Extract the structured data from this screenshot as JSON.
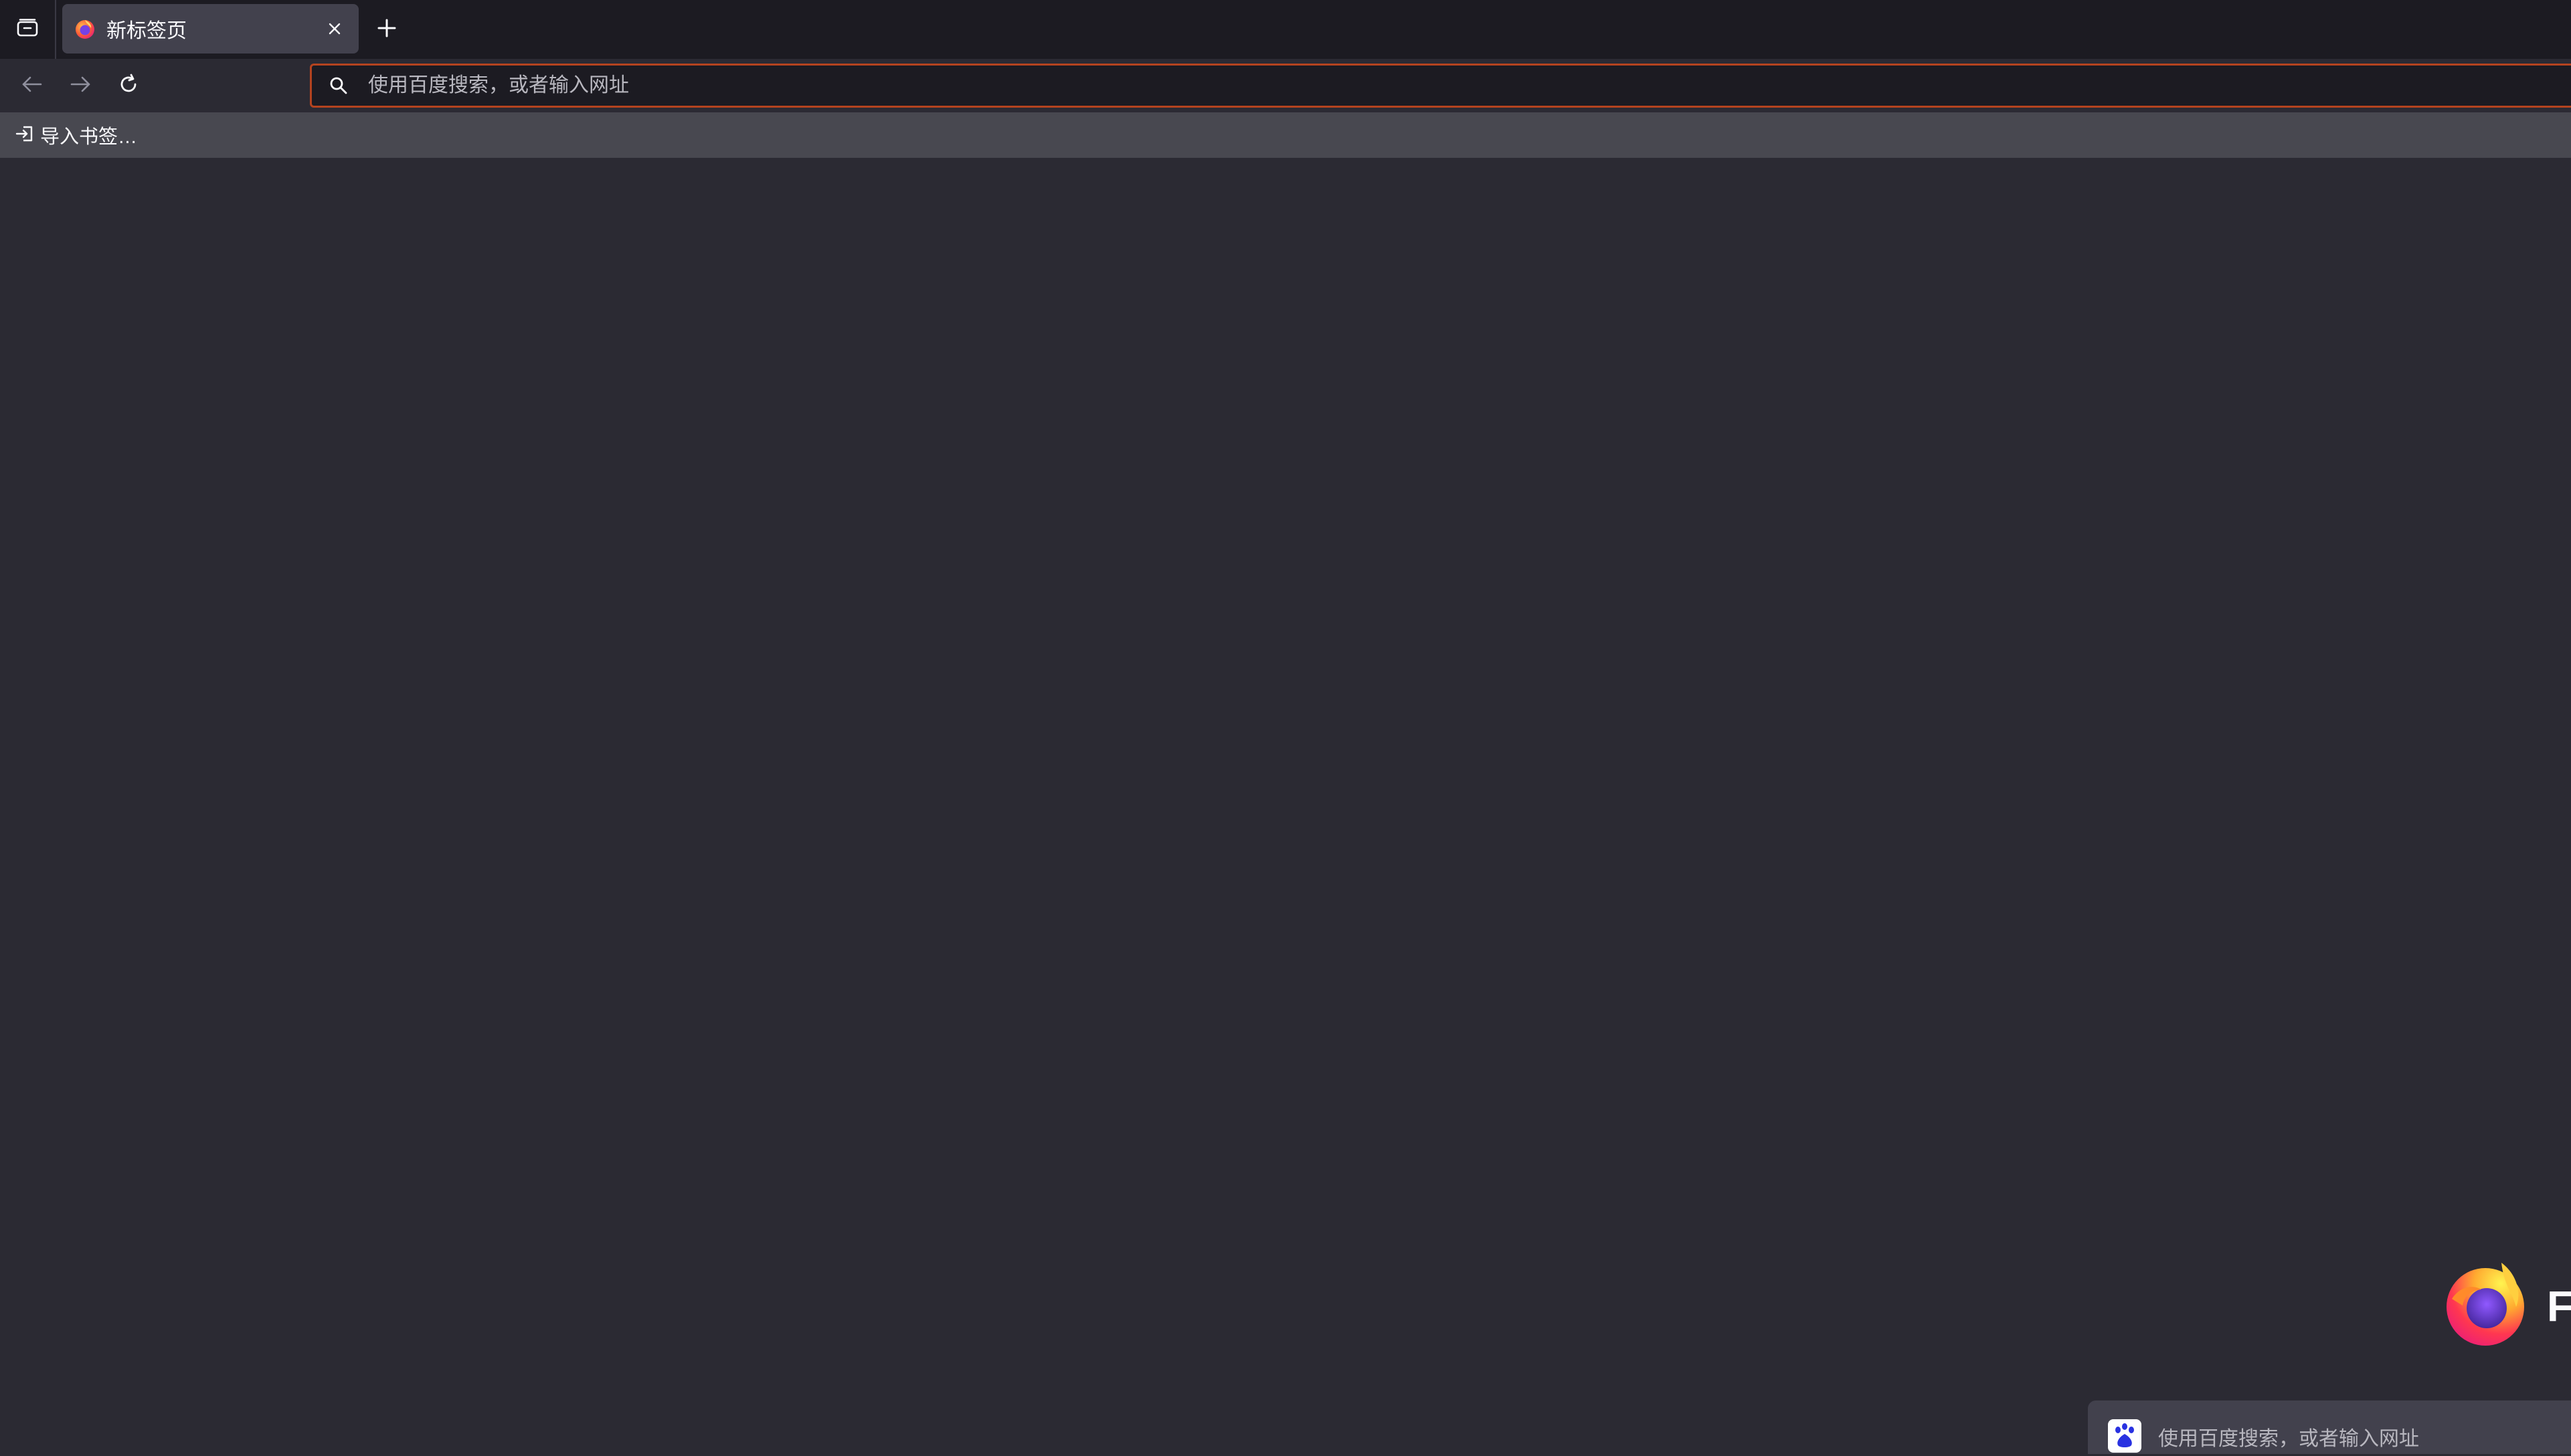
{
  "tabbar": {
    "tab_list_icon": "tab-list-icon",
    "tabs": [
      {
        "title": "新标签页",
        "favicon": "firefox-favicon-icon",
        "close_icon": "close-icon"
      }
    ],
    "new_tab_icon": "plus-icon"
  },
  "navbar": {
    "back_icon": "arrow-left-icon",
    "forward_icon": "arrow-right-icon",
    "reload_icon": "reload-icon",
    "url": {
      "search_icon": "search-icon",
      "placeholder": "使用百度搜索，或者输入网址",
      "value": ""
    }
  },
  "bookmarks": {
    "items": [
      {
        "label": "导入书签…",
        "icon": "import-icon"
      }
    ]
  },
  "newtab": {
    "logo_icon": "firefox-logo-icon",
    "wordmark": "F",
    "search": {
      "engine_icon": "baidu-icon",
      "placeholder": "使用百度搜索，或者输入网址"
    }
  },
  "colors": {
    "tabbar_bg": "#1c1b22",
    "content_bg": "#2b2a33",
    "urlbar_focus_border": "#b4431f",
    "bookmarks_bg": "#484850",
    "active_tab_bg": "#42414d"
  }
}
